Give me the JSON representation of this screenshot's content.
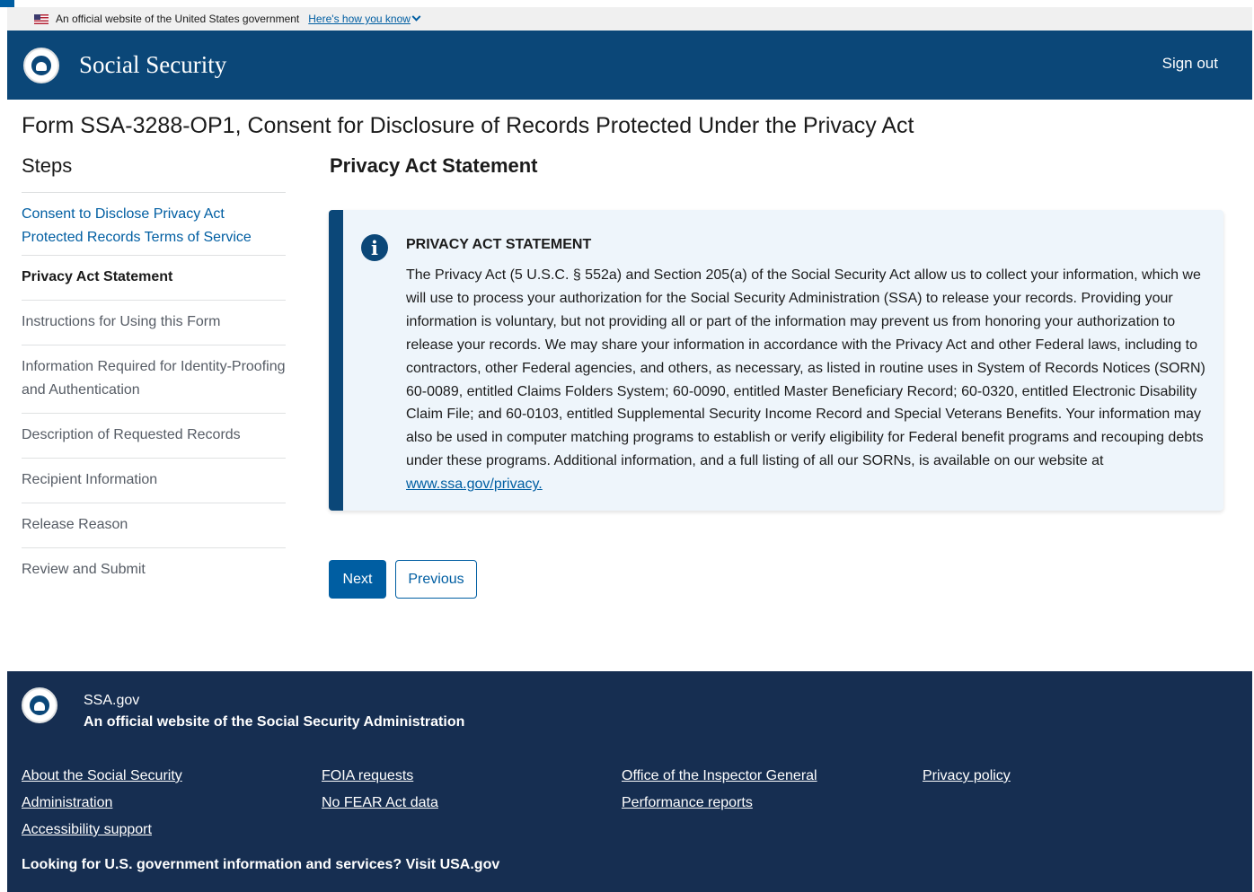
{
  "gov_banner": {
    "text": "An official website of the United States government",
    "link": "Here's how you know"
  },
  "header": {
    "title": "Social Security",
    "sign_out": "Sign out"
  },
  "form_title": "Form SSA-3288-OP1, Consent for Disclosure of Records Protected Under the Privacy Act",
  "steps": {
    "heading": "Steps",
    "items": [
      {
        "label": "Consent to Disclose Privacy Act Protected Records Terms of Service",
        "state": "link"
      },
      {
        "label": "Privacy Act Statement",
        "state": "current"
      },
      {
        "label": "Instructions for Using this Form",
        "state": "inactive"
      },
      {
        "label": "Information Required for Identity-Proofing and Authentication",
        "state": "inactive"
      },
      {
        "label": "Description of Requested Records",
        "state": "inactive"
      },
      {
        "label": "Recipient Information",
        "state": "inactive"
      },
      {
        "label": "Release Reason",
        "state": "inactive"
      },
      {
        "label": "Review and Submit",
        "state": "inactive"
      }
    ]
  },
  "main": {
    "heading": "Privacy Act Statement",
    "alert": {
      "heading": "PRIVACY ACT STATEMENT",
      "body": "The Privacy Act (5 U.S.C. § 552a) and Section 205(a) of the Social Security Act allow us to collect your information, which we will use to process your authorization for the Social Security Administration (SSA) to release your records. Providing your information is voluntary, but not providing all or part of the information may prevent us from honoring your authorization to release your records.  We may share your information in accordance with the Privacy Act and other Federal laws, including to contractors, other Federal agencies, and others, as necessary, as listed in routine uses in System of Records Notices (SORN) 60-0089, entitled Claims Folders System; 60-0090, entitled Master Beneficiary Record; 60-0320, entitled Electronic Disability Claim File; and 60-0103, entitled Supplemental Security Income Record and Special Veterans Benefits.  Your information may also be used in computer matching programs to establish or verify eligibility for Federal benefit programs and recouping debts under these programs.  Additional information, and a full listing of all our SORNs, is available on our website at",
      "link": "www.ssa.gov/privacy."
    },
    "buttons": {
      "next": "Next",
      "previous": "Previous"
    }
  },
  "footer": {
    "site": "SSA.gov",
    "official": "An official website of the Social Security Administration",
    "col1": [
      "About the Social Security Administration",
      "Accessibility support"
    ],
    "col2": [
      "FOIA requests",
      "No FEAR Act data"
    ],
    "col3": [
      "Office of the Inspector General",
      "Performance reports"
    ],
    "col4": [
      "Privacy policy"
    ],
    "looking": "Looking for U.S. government information and services?",
    "visit": "Visit USA.gov"
  },
  "colors": {
    "header_bg": "#0b4778",
    "footer_bg": "#162e51",
    "link": "#005ea2",
    "alert_bg": "#eef5fb"
  }
}
